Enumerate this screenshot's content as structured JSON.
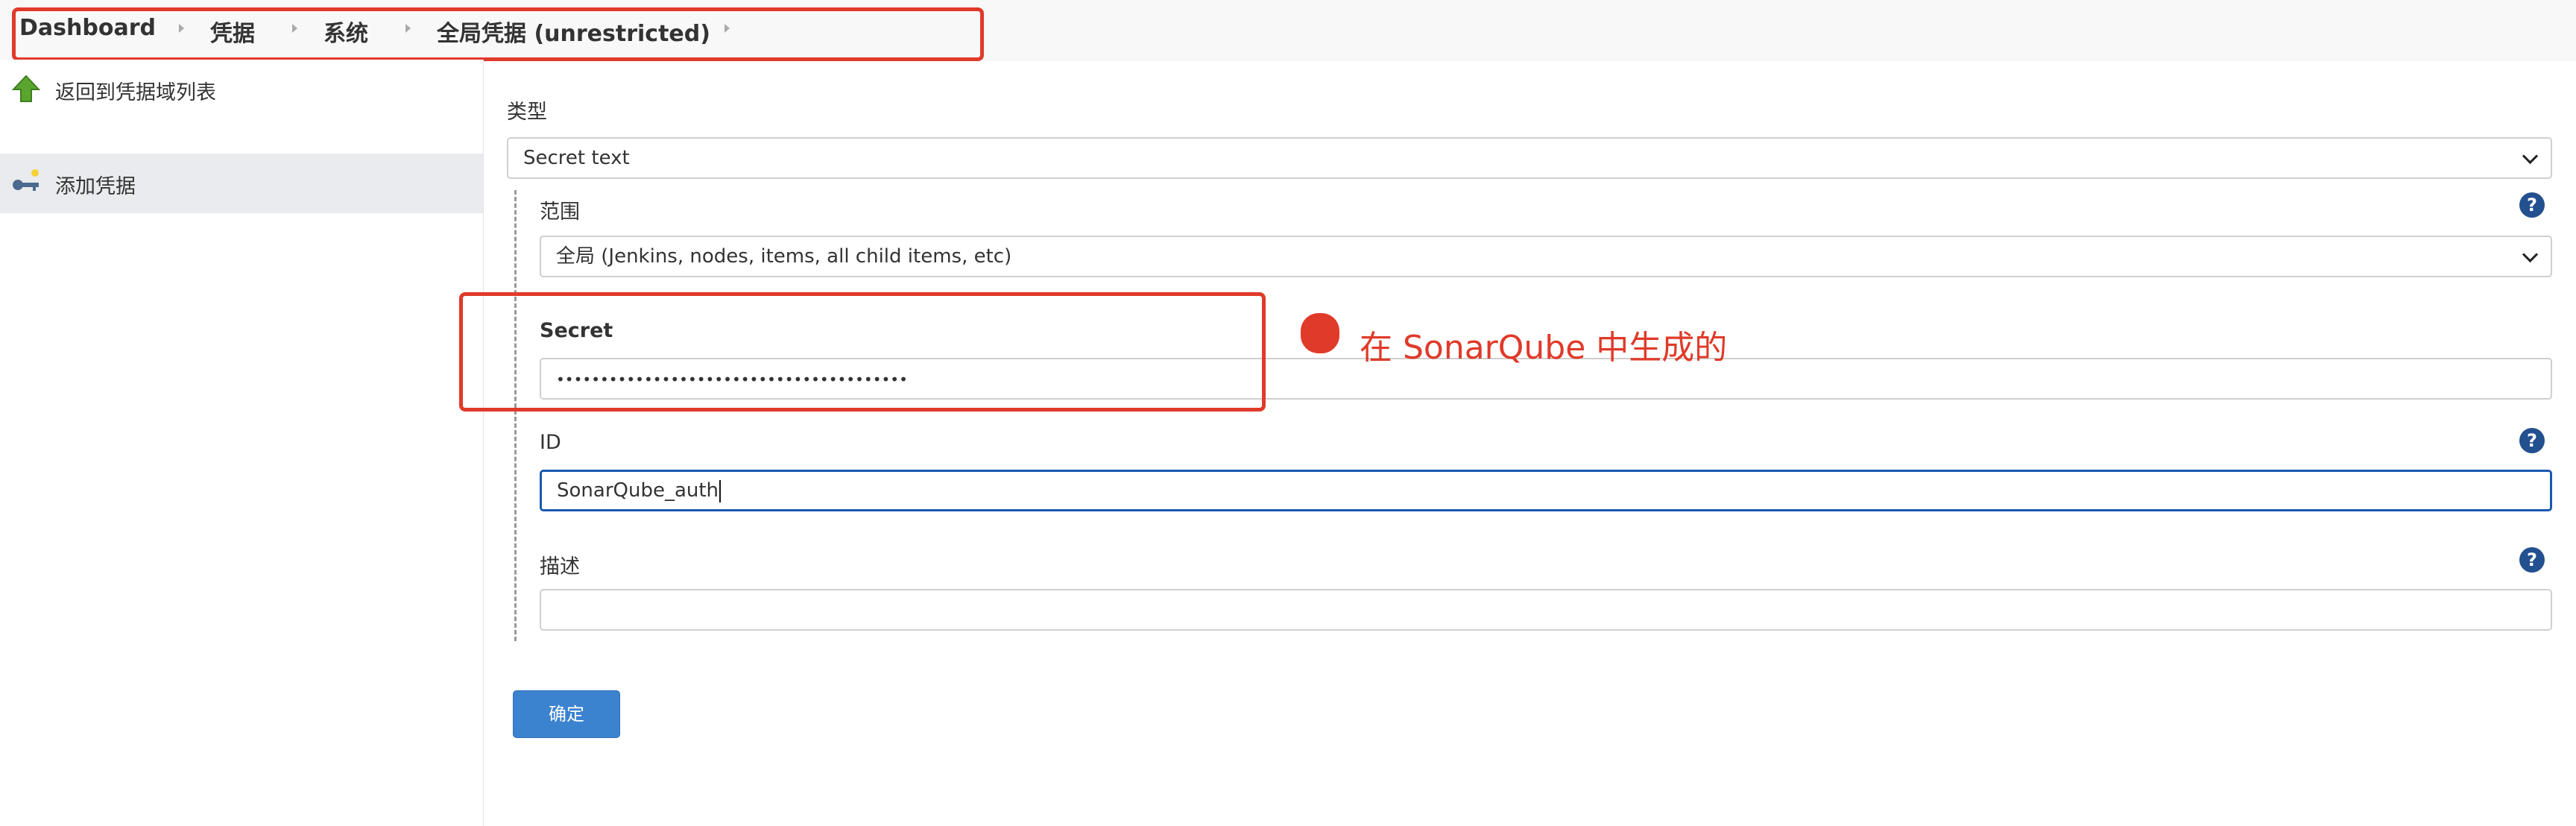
{
  "breadcrumb": {
    "items": [
      "Dashboard",
      "凭据",
      "系统",
      "全局凭据 (unrestricted)"
    ]
  },
  "sidebar": {
    "items": [
      {
        "label": "返回到凭据域列表",
        "icon": "up-arrow-icon"
      },
      {
        "label": "添加凭据",
        "icon": "key-icon"
      }
    ]
  },
  "form": {
    "type_label": "类型",
    "type_value": "Secret text",
    "scope_label": "范围",
    "scope_value": "全局 (Jenkins, nodes, items, all child items, etc)",
    "secret_label": "Secret",
    "secret_value": "••••••••••••••••••••••••••••••••••••••••",
    "id_label": "ID",
    "id_value": "SonarQube_auth",
    "desc_label": "描述",
    "desc_value": "",
    "help_symbol": "?",
    "submit_label": "确定"
  },
  "annotation": {
    "text": "在 SonarQube 中生成的"
  },
  "colors": {
    "annotation_red": "#e03a2a",
    "button_blue": "#3b82cf",
    "help_blue": "#23508f",
    "focus_blue": "#1a57b0"
  }
}
